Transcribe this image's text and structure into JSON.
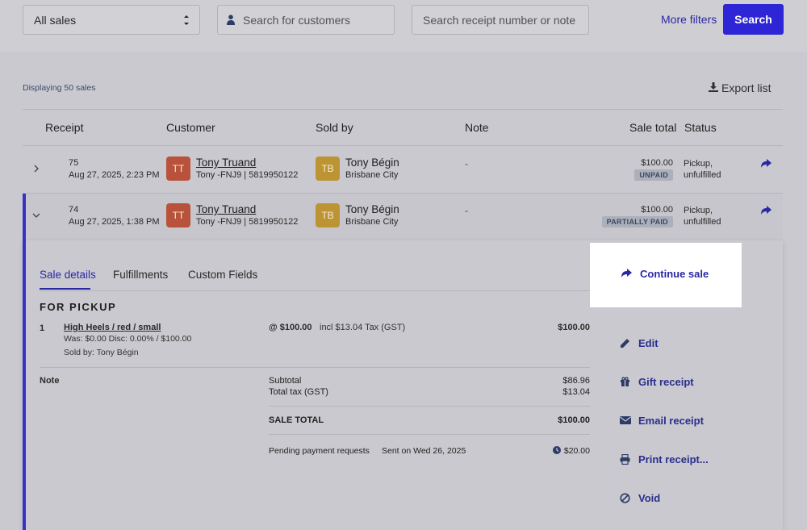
{
  "filters": {
    "sales_select": "All sales",
    "customer_placeholder": "Search for customers",
    "receipt_placeholder": "Search receipt number or note",
    "more_filters": "More filters",
    "search": "Search"
  },
  "summary": {
    "displaying": "Displaying 50 sales",
    "export": "Export list"
  },
  "table": {
    "headers": {
      "receipt": "Receipt",
      "customer": "Customer",
      "sold_by": "Sold by",
      "note": "Note",
      "sale_total": "Sale total",
      "status": "Status"
    },
    "rows": [
      {
        "receipt": "75",
        "date": "Aug 27, 2025, 2:23 PM",
        "customer_initials": "TT",
        "customer_name": "Tony Truand",
        "customer_sub": "Tony -FNJ9 | 5819950122",
        "seller_initials": "TB",
        "seller_name": "Tony Bégin",
        "seller_outlet": "Brisbane City",
        "note": "-",
        "total": "$100.00",
        "payment": "UNPAID",
        "status_1": "Pickup,",
        "status_2": "unfulfilled"
      },
      {
        "receipt": "74",
        "date": "Aug 27, 2025, 1:38 PM",
        "customer_initials": "TT",
        "customer_name": "Tony Truand",
        "customer_sub": "Tony -FNJ9 | 5819950122",
        "seller_initials": "TB",
        "seller_name": "Tony Bégin",
        "seller_outlet": "Brisbane City",
        "note": "-",
        "total": "$100.00",
        "payment": "PARTIALLY PAID",
        "status_1": "Pickup,",
        "status_2": "unfulfilled"
      }
    ]
  },
  "details": {
    "tabs": [
      "Sale details",
      "Fulfillments",
      "Custom Fields"
    ],
    "section_title": "FOR PICKUP",
    "line_item": {
      "qty": "1",
      "name": "High Heels / red / small",
      "was": "Was: $0.00 Disc: 0.00% / $100.00",
      "sold_by": "Sold by: Tony Bégin",
      "unit_price": "@ $100.00",
      "tax": "incl $13.04 Tax (GST)",
      "total": "$100.00"
    },
    "note_label": "Note",
    "subtotal_label": "Subtotal",
    "subtotal": "$86.96",
    "tax_label": "Total tax (GST)",
    "tax": "$13.04",
    "sale_total_label": "SALE TOTAL",
    "sale_total": "$100.00",
    "pending_label": "Pending payment requests",
    "pending_sent": "Sent on Wed 26, 2025",
    "pending_amount": "$20.00"
  },
  "actions": {
    "continue_sale": "Continue sale",
    "edit": "Edit",
    "gift_receipt": "Gift receipt",
    "email_receipt": "Email receipt",
    "print_receipt": "Print receipt...",
    "void": "Void"
  },
  "colors": {
    "accent": "#2d25d6",
    "link": "#2b28a6",
    "customer_avatar": "#b8523a",
    "seller_avatar": "#bd9433"
  }
}
